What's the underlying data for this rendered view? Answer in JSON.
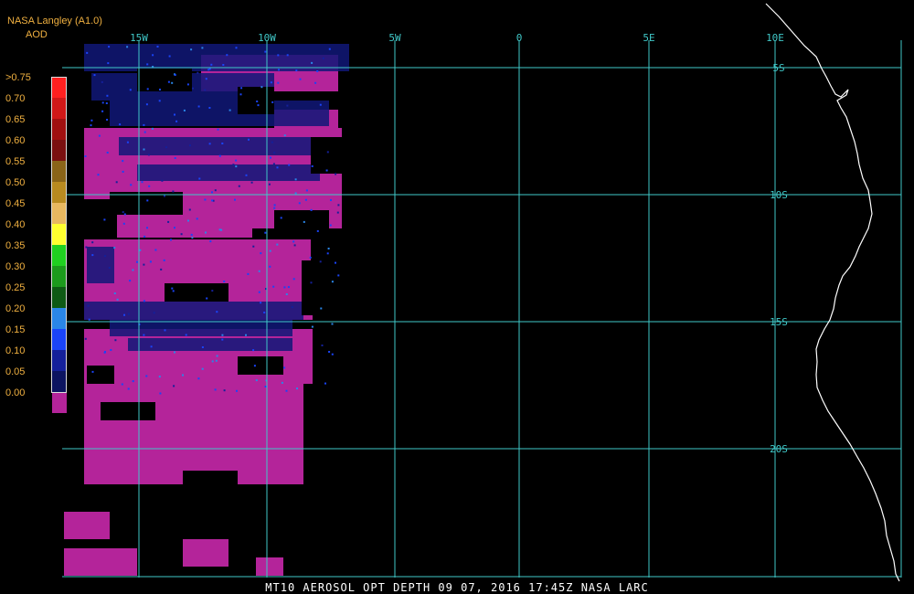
{
  "header": {
    "source": "NASA Langley (A1.0)",
    "product": "AOD"
  },
  "colors": {
    "text_orange": "#f0b040",
    "grid": "#40c8c8",
    "coast": "#ffffff",
    "aod_low": "#b4249a"
  },
  "legend": [
    {
      "label": ">0.75",
      "color": "#ff2020"
    },
    {
      "label": "0.70",
      "color": "#d01818"
    },
    {
      "label": "0.65",
      "color": "#a01010"
    },
    {
      "label": "0.60",
      "color": "#7a1010"
    },
    {
      "label": "0.55",
      "color": "#8a6418"
    },
    {
      "label": "0.50",
      "color": "#b88a20"
    },
    {
      "label": "0.45",
      "color": "#e8b860"
    },
    {
      "label": "0.40",
      "color": "#ffff30"
    },
    {
      "label": "0.35",
      "color": "#20d020"
    },
    {
      "label": "0.30",
      "color": "#1c9a1c"
    },
    {
      "label": "0.25",
      "color": "#0e5a14"
    },
    {
      "label": "0.20",
      "color": "#2a86e8"
    },
    {
      "label": "0.15",
      "color": "#1a44f8"
    },
    {
      "label": "0.10",
      "color": "#14209a"
    },
    {
      "label": "0.05",
      "color": "#0c1460"
    },
    {
      "label": "0.00",
      "color": "#b4249a"
    }
  ],
  "grid": {
    "longitudes": [
      "15W",
      "10W",
      "5W",
      "0",
      "5E",
      "10E"
    ],
    "latitudes": [
      "5S",
      "10S",
      "15S",
      "20S"
    ]
  },
  "footer": "MT10  AEROSOL OPT DEPTH   09 07, 2016 17:45Z   NASA LARC"
}
